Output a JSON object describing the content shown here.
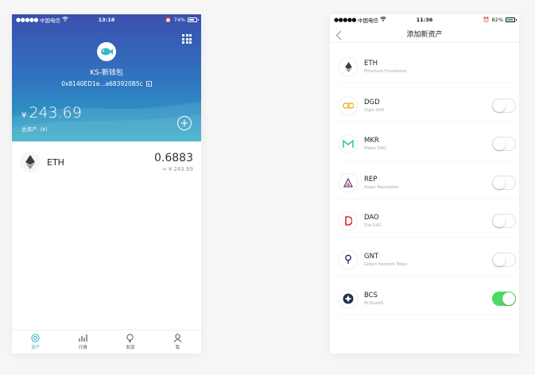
{
  "wallet_screen": {
    "status": {
      "carrier": "中国电信",
      "time": "13:18",
      "battery": "74%",
      "battery_level": 0.74
    },
    "wallet_name": "KS-新钱包",
    "address": "0x8140ED1e...a683920B5c",
    "balance": {
      "currency": "¥",
      "value": "243.69",
      "label": "总资产（¥）"
    },
    "assets": [
      {
        "symbol": "ETH",
        "amount": "0.6883",
        "fiat": "≈ ¥ 243.69",
        "icon": "ethereum-icon"
      }
    ],
    "tabs": [
      {
        "label": "资产",
        "icon": "assets-icon",
        "active": true
      },
      {
        "label": "行情",
        "icon": "market-icon",
        "active": false
      },
      {
        "label": "发现",
        "icon": "discover-icon",
        "active": false
      },
      {
        "label": "我",
        "icon": "profile-icon",
        "active": false
      }
    ]
  },
  "add_asset_screen": {
    "status": {
      "carrier": "中国电信",
      "time": "11:36",
      "battery": "82%",
      "battery_level": 0.82
    },
    "title": "添加新资产",
    "tokens": [
      {
        "symbol": "ETH",
        "name": "Ethereum Foundation",
        "toggle": null,
        "icon": "ethereum-icon",
        "color": "#3c3c3d"
      },
      {
        "symbol": "DGD",
        "name": "Digix DAO",
        "toggle": false,
        "icon": "digix-icon",
        "color": "#f0b429"
      },
      {
        "symbol": "MKR",
        "name": "Maker DAO",
        "toggle": false,
        "icon": "maker-icon",
        "color": "#36c6a8"
      },
      {
        "symbol": "REP",
        "name": "Augur Reputation",
        "toggle": false,
        "icon": "augur-icon",
        "color": "#7a3a6e"
      },
      {
        "symbol": "DAO",
        "name": "The DAO",
        "toggle": false,
        "icon": "dao-icon",
        "color": "#e4262b"
      },
      {
        "symbol": "GNT",
        "name": "Golem Network Token",
        "toggle": false,
        "icon": "golem-icon",
        "color": "#1b2b5a"
      },
      {
        "symbol": "BCS",
        "name": "BCShareS",
        "toggle": true,
        "icon": "bcshares-icon",
        "color": "#24324f"
      }
    ]
  },
  "colors": {
    "accent": "#2fb3c9",
    "header_top": "#3b4fae",
    "header_bottom": "#2eabc6",
    "toggle_on": "#4cd964"
  }
}
